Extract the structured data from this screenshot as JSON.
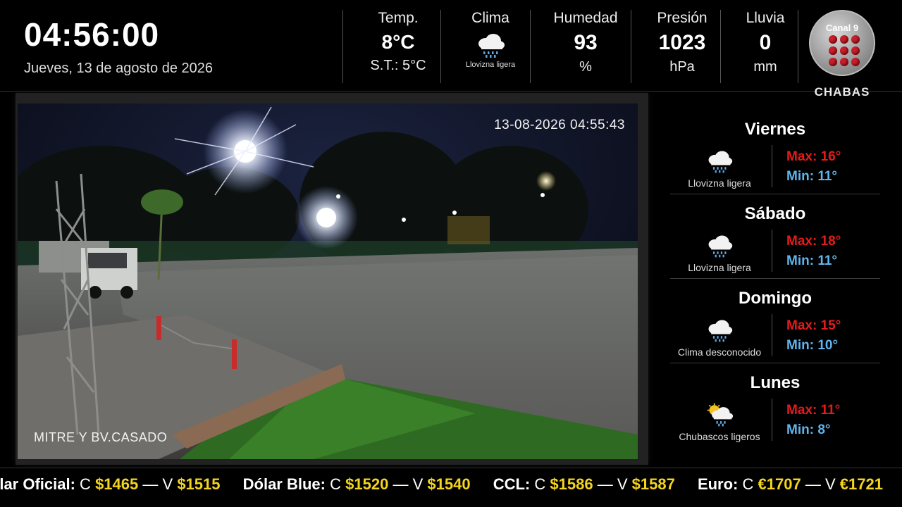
{
  "clock": "04:56:00",
  "date": "Jueves, 13 de agosto de 2026",
  "weather_now": {
    "temp_label": "Temp.",
    "temp_value": "8°C",
    "feels_like": "S.T.: 5°C",
    "clima_label": "Clima",
    "clima_icon": "rain-cloud-icon",
    "clima_text": "Llovizna ligera",
    "humidity_label": "Humedad",
    "humidity_value": "93",
    "humidity_unit": "%",
    "pressure_label": "Presión",
    "pressure_value": "1023",
    "pressure_unit": "hPa",
    "rain_label": "Lluvia",
    "rain_value": "0",
    "rain_unit": "mm"
  },
  "logo": {
    "title": "Canal 9",
    "brand": "CHABAS"
  },
  "camera": {
    "timestamp": "13-08-2026 04:55:43",
    "location": "MITRE Y BV.CASADO"
  },
  "forecast": [
    {
      "day": "Viernes",
      "icon": "rain-cloud-icon",
      "condition": "Llovizna ligera",
      "max": "Max: 16°",
      "min": "Min: 11°"
    },
    {
      "day": "Sábado",
      "icon": "rain-cloud-icon",
      "condition": "Llovizna ligera",
      "max": "Max: 18°",
      "min": "Min: 11°"
    },
    {
      "day": "Domingo",
      "icon": "rain-cloud-icon",
      "condition": "Clima desconocido",
      "max": "Max: 15°",
      "min": "Min: 10°"
    },
    {
      "day": "Lunes",
      "icon": "sun-rain-cloud-icon",
      "condition": "Chubascos ligeros",
      "max": "Max: 11°",
      "min": "Min: 8°"
    }
  ],
  "ticker": [
    {
      "name": "Dólar Oficial:",
      "buy_letter": "C",
      "buy": "$1465",
      "dash": "—",
      "sell_letter": "V",
      "sell": "$1515"
    },
    {
      "name": "Dólar Blue:",
      "buy_letter": "C",
      "buy": "$1520",
      "dash": "—",
      "sell_letter": "V",
      "sell": "$1540"
    },
    {
      "name": "CCL:",
      "buy_letter": "C",
      "buy": "$1586",
      "dash": "—",
      "sell_letter": "V",
      "sell": "$1587"
    },
    {
      "name": "Euro:",
      "buy_letter": "C",
      "buy": "€1707",
      "dash": "—",
      "sell_letter": "V",
      "sell": "€1721"
    }
  ],
  "colors": {
    "max_temp": "#e51b1b",
    "min_temp": "#5fb6ee",
    "price": "#f4d51e",
    "logo_red": "#c81f2a"
  }
}
